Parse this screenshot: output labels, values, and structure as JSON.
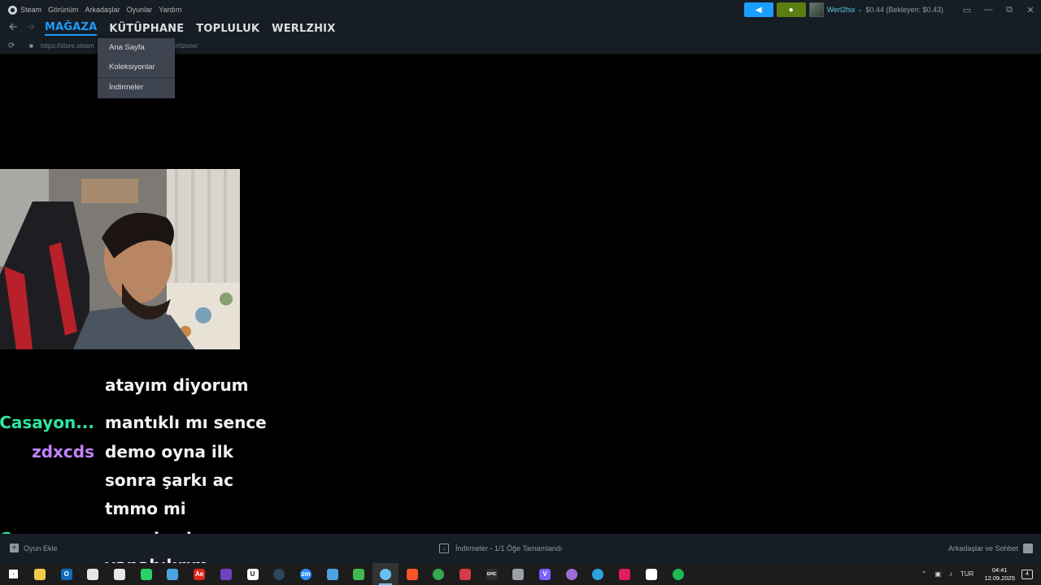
{
  "menubar": {
    "items": [
      "Steam",
      "Görünüm",
      "Arkadaşlar",
      "Oyunlar",
      "Yardım"
    ],
    "username": "Werl2hix",
    "balance": "$0.44 (Bekleyen: $0.43)"
  },
  "nav": {
    "links": [
      "MAĞAZA",
      "KÜTÜPHANE",
      "TOPLULUK",
      "WERLZHIX"
    ],
    "active": "MAĞAZA"
  },
  "urlbar": {
    "url_start": "https://store.steam",
    "url_end": "950/Dirtzone/"
  },
  "dropdown": {
    "items": [
      "Ana Sayfa",
      "Koleksiyonlar",
      "İndirmeler"
    ]
  },
  "chat": {
    "lines": [
      {
        "nick": "",
        "message": "atayım diyorum",
        "color": "#2ee6a0"
      },
      {
        "nick": "Casayon...",
        "message": "mantıklı mı sence",
        "color": "#2ee6a0"
      },
      {
        "nick": "zdxcds",
        "message": "demo oyna ilk",
        "color": "#c084fc"
      },
      {
        "nick": "",
        "message": "sonra şarkı ac",
        "color": "#c084fc"
      },
      {
        "nick": "",
        "message": "tmmo mi",
        "color": "#c084fc"
      },
      {
        "nick": "Casayon...",
        "message": "veya baska ne",
        "color": "#2ee6a0"
      },
      {
        "nick": "",
        "message": "yapabılırım",
        "color": "#2ee6a0"
      }
    ]
  },
  "bottombar": {
    "add_game": "Oyun Ekle",
    "downloads": "İndirmeler - 1/1 Öğe Tamamlandı",
    "friends": "Arkadaşlar ve Sohbet"
  },
  "taskbar": {
    "language": "TUR",
    "time": "04:41",
    "date": "12.09.2025",
    "notifications": "4",
    "apps": [
      {
        "name": "windows-start-icon",
        "color": "#ffffff",
        "label": ""
      },
      {
        "name": "file-explorer-icon",
        "color": "#f2c94c",
        "label": ""
      },
      {
        "name": "outlook-icon",
        "color": "#0f6cbd",
        "label": "O"
      },
      {
        "name": "notepad-icon",
        "color": "#e6e6e6",
        "label": ""
      },
      {
        "name": "document-icon",
        "color": "#e6e6e6",
        "label": ""
      },
      {
        "name": "whatsapp-icon",
        "color": "#25d366",
        "label": ""
      },
      {
        "name": "monitor-icon",
        "color": "#4aa3df",
        "label": ""
      },
      {
        "name": "adobe-icon",
        "color": "#e1251b",
        "label": "Ae"
      },
      {
        "name": "app-icon",
        "color": "#6f42c1",
        "label": ""
      },
      {
        "name": "unreal-engine-icon",
        "color": "#ffffff",
        "label": "U"
      },
      {
        "name": "steam-icon",
        "color": "#2a475e",
        "label": ""
      },
      {
        "name": "zoom-icon",
        "color": "#2d8cff",
        "label": "zm"
      },
      {
        "name": "window-icon",
        "color": "#4aa3df",
        "label": ""
      },
      {
        "name": "spark-icon",
        "color": "#3fb950",
        "label": ""
      },
      {
        "name": "steam-active-icon",
        "color": "#66c0f4",
        "label": ""
      },
      {
        "name": "brave-icon",
        "color": "#fb542b",
        "label": ""
      },
      {
        "name": "chrome-icon",
        "color": "#34a853",
        "label": ""
      },
      {
        "name": "record-icon",
        "color": "#d73a49",
        "label": ""
      },
      {
        "name": "epic-games-icon",
        "color": "#2f2f2f",
        "label": "EPIC"
      },
      {
        "name": "installer-icon",
        "color": "#9aa0a6",
        "label": ""
      },
      {
        "name": "vegas-icon",
        "color": "#7b61ff",
        "label": "V"
      },
      {
        "name": "obs-icon",
        "color": "#a06cd5",
        "label": ""
      },
      {
        "name": "telegram-icon",
        "color": "#2aa3e0",
        "label": ""
      },
      {
        "name": "slack-icon",
        "color": "#e01e5a",
        "label": ""
      },
      {
        "name": "capcut-icon",
        "color": "#ffffff",
        "label": ""
      },
      {
        "name": "spotify-icon",
        "color": "#1db954",
        "label": ""
      }
    ]
  }
}
